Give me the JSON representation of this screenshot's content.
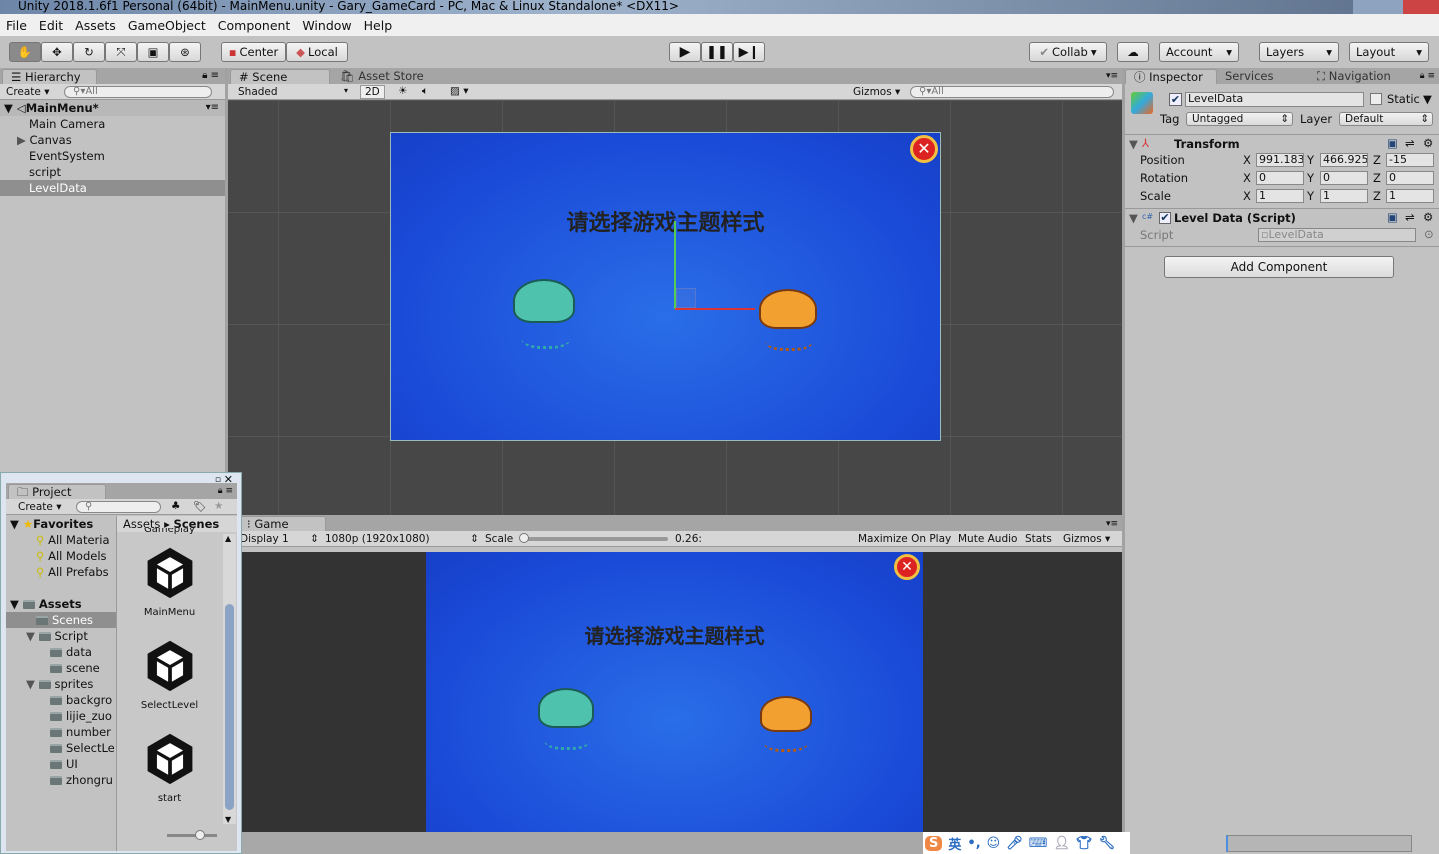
{
  "window": {
    "title": "Unity 2018.1.6f1 Personal (64bit) - MainMenu.unity - Gary_GameCard - PC, Mac & Linux Standalone* <DX11>"
  },
  "menu": [
    "File",
    "Edit",
    "Assets",
    "GameObject",
    "Component",
    "Window",
    "Help"
  ],
  "toolbar": {
    "tools": [
      "hand-tool",
      "move-tool",
      "rotate-tool",
      "scale-tool",
      "rect-tool",
      "transform-tool"
    ],
    "pivot": "Center",
    "space": "Local",
    "play": "play",
    "pause": "pause",
    "step": "step",
    "collab": "Collab",
    "account": "Account",
    "layers": "Layers",
    "layout": "Layout"
  },
  "hierarchy": {
    "tab": "Hierarchy",
    "create": "Create",
    "search_placeholder": "All",
    "scene": "MainMenu*",
    "items": [
      "Main Camera",
      "Canvas",
      "EventSystem",
      "script",
      "LevelData"
    ],
    "selected": "LevelData"
  },
  "scene": {
    "tab": "Scene",
    "tab2": "Asset Store",
    "shading": "Shaded",
    "mode2d": "2D",
    "gizmos": "Gizmos",
    "search_placeholder": "All",
    "title_text": "请选择游戏主题样式"
  },
  "game": {
    "tab": "Game",
    "display": "Display 1",
    "resolution": "1080p (1920x1080)",
    "scale_label": "Scale",
    "scale_value": "0.26:",
    "scale_fraction": 0.0,
    "maximize": "Maximize On Play",
    "mute": "Mute Audio",
    "stats": "Stats",
    "gizmos": "Gizmos",
    "title_text": "请选择游戏主题样式"
  },
  "inspector": {
    "tab": "Inspector",
    "tab2": "Services",
    "tab3": "Navigation",
    "object_name": "LevelData",
    "active": true,
    "static_label": "Static",
    "tag_label": "Tag",
    "tag": "Untagged",
    "layer_label": "Layer",
    "layer": "Default",
    "transform": {
      "title": "Transform",
      "position_label": "Position",
      "rotation_label": "Rotation",
      "scale_label": "Scale",
      "position": {
        "x": "991.183",
        "y": "466.925",
        "z": "-15"
      },
      "rotation": {
        "x": "0",
        "y": "0",
        "z": "0"
      },
      "scale": {
        "x": "1",
        "y": "1",
        "z": "1"
      }
    },
    "script_component": {
      "title": "Level Data (Script)",
      "script_label": "Script",
      "script_value": "LevelData"
    },
    "add_component": "Add Component"
  },
  "project": {
    "tab": "Project",
    "create": "Create",
    "favorites_label": "Favorites",
    "favorites": [
      "All Materia",
      "All Models",
      "All Prefabs"
    ],
    "assets_label": "Assets",
    "tree": [
      {
        "name": "Scenes",
        "depth": 1
      },
      {
        "name": "Script",
        "depth": 1
      },
      {
        "name": "data",
        "depth": 2
      },
      {
        "name": "scene",
        "depth": 2
      },
      {
        "name": "sprites",
        "depth": 1
      },
      {
        "name": "backgro",
        "depth": 2
      },
      {
        "name": "lijie_zuo",
        "depth": 2
      },
      {
        "name": "number",
        "depth": 2
      },
      {
        "name": "SelectLe",
        "depth": 2
      },
      {
        "name": "UI",
        "depth": 2
      },
      {
        "name": "zhongru",
        "depth": 2
      }
    ],
    "breadcrumb": [
      "Assets",
      "Scenes"
    ],
    "partial_item": "Gameplay",
    "scenes": [
      "MainMenu",
      "SelectLevel",
      "start"
    ]
  },
  "ime": {
    "lang": "英",
    "punct": "•,"
  },
  "colors": {
    "panel": "#c2c2c2",
    "scene_bg": "#474747",
    "canvas_blue": "#1f52e0",
    "selection": "#8f8f8f"
  }
}
